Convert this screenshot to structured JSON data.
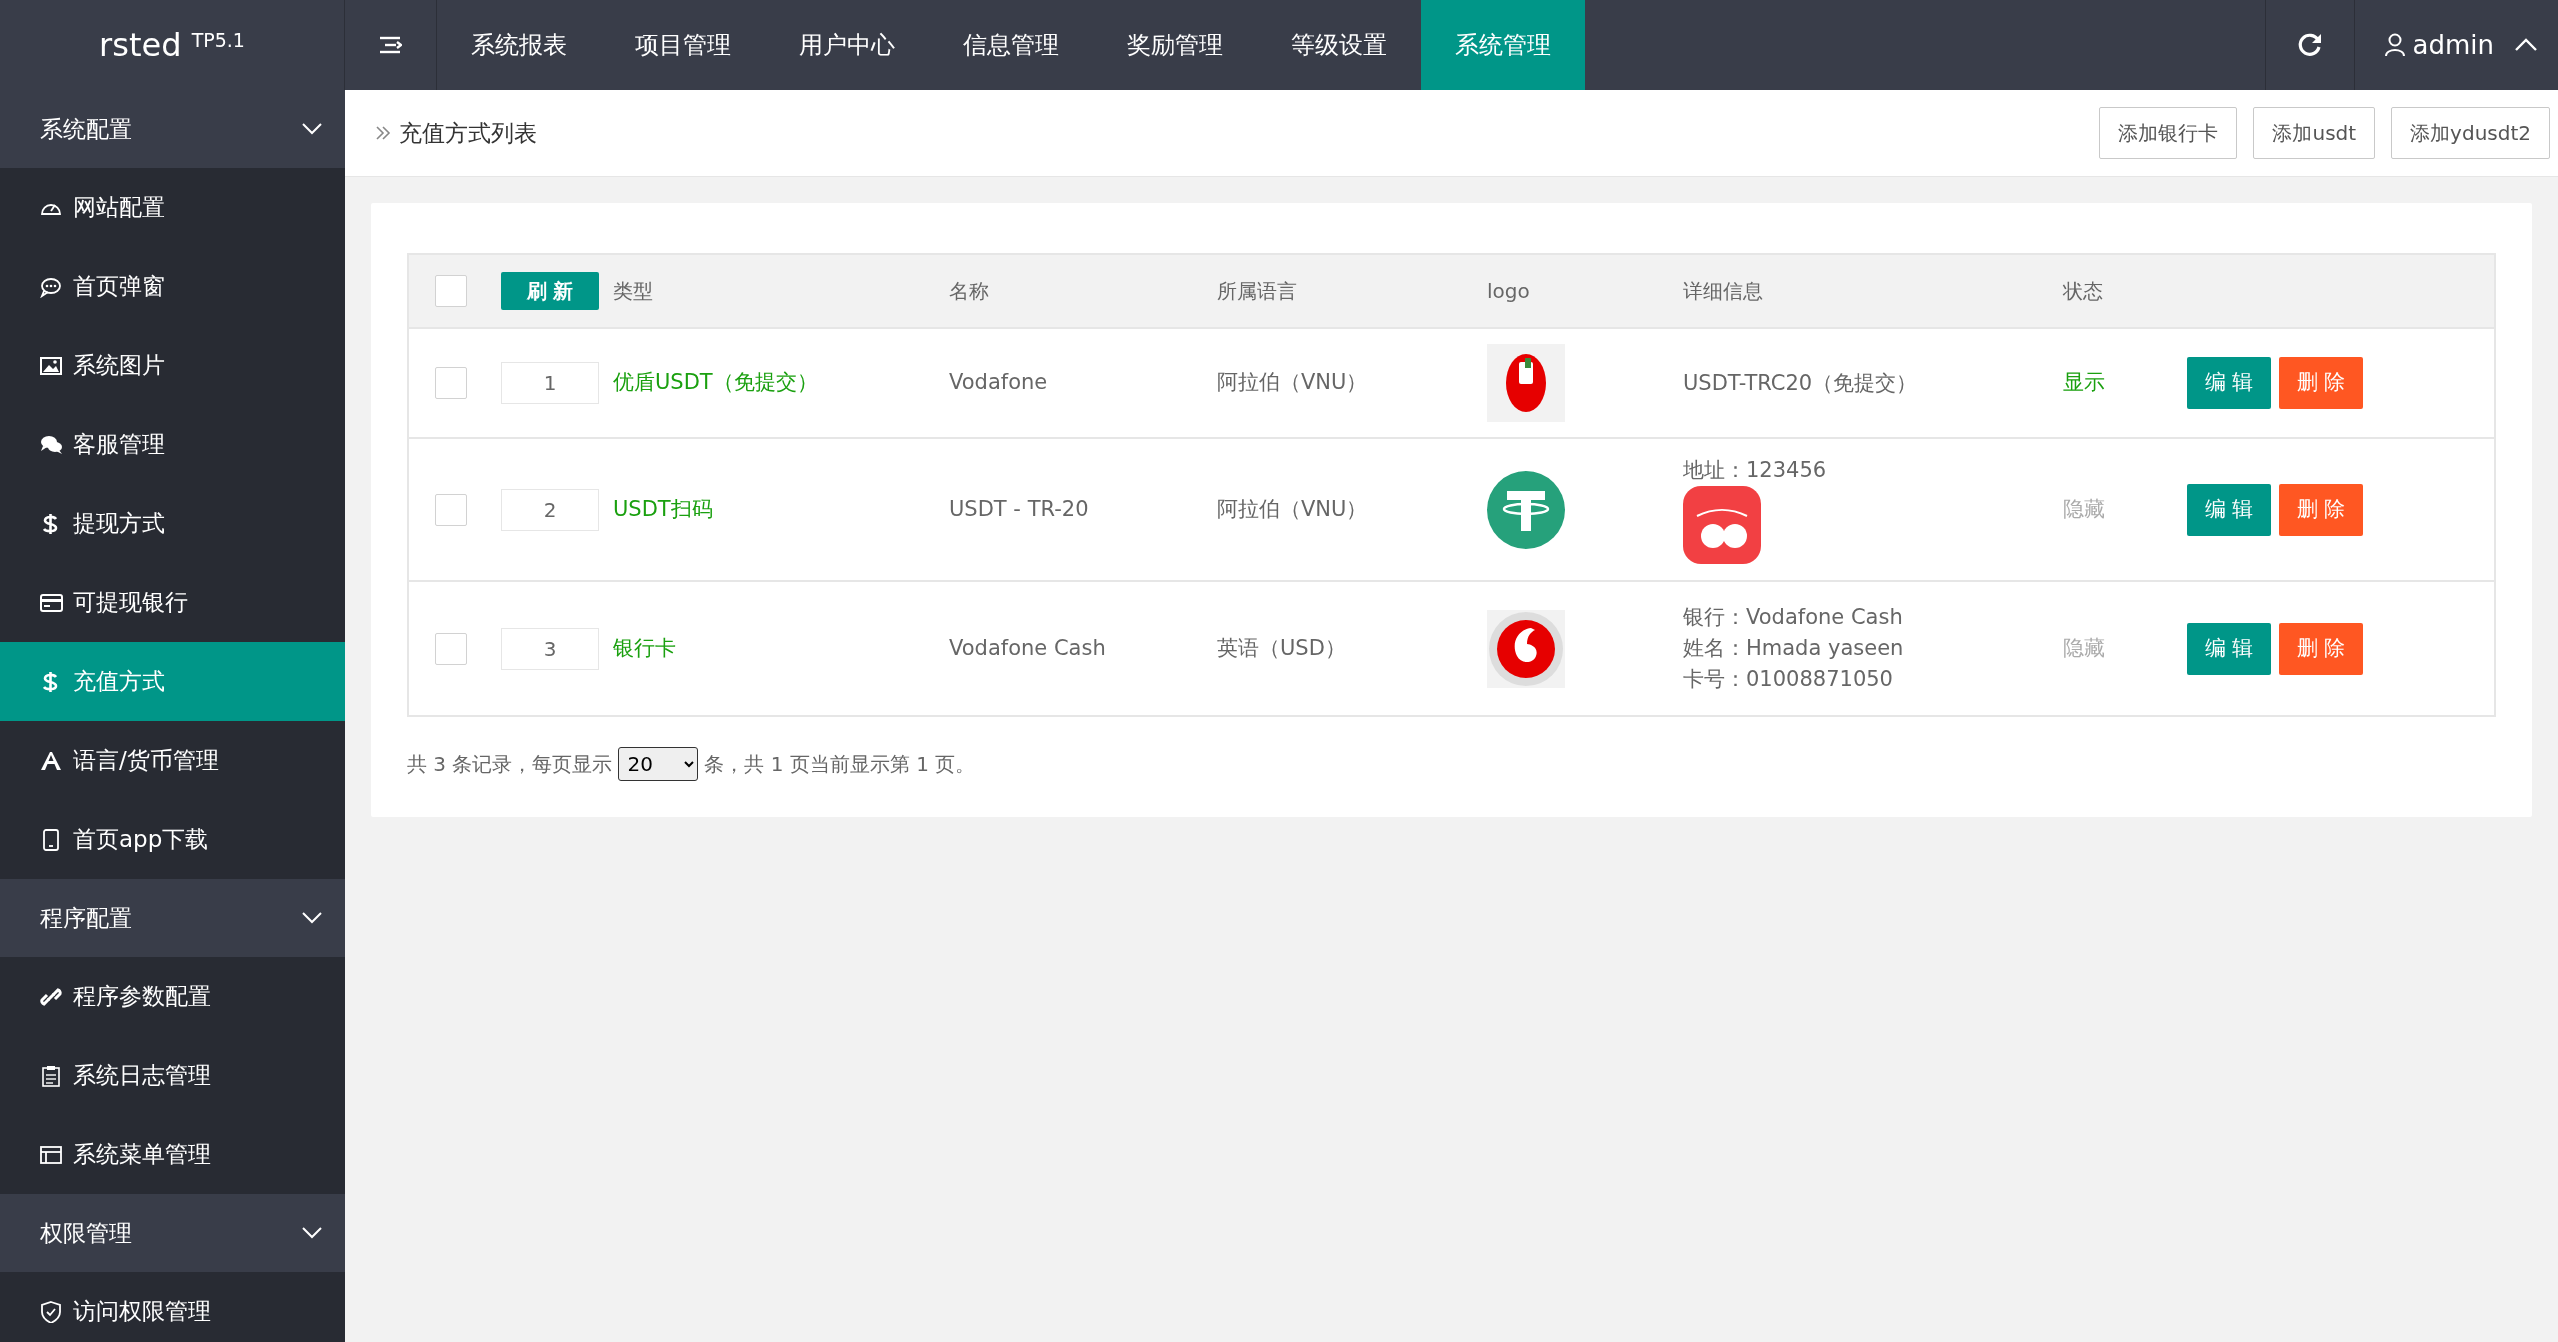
{
  "brand": {
    "name": "rsted",
    "version": "TP5.1"
  },
  "top_nav": [
    {
      "label": "系统报表",
      "selected": false
    },
    {
      "label": "项目管理",
      "selected": false
    },
    {
      "label": "用户中心",
      "selected": false
    },
    {
      "label": "信息管理",
      "selected": false
    },
    {
      "label": "奖励管理",
      "selected": false
    },
    {
      "label": "等级设置",
      "selected": false
    },
    {
      "label": "系统管理",
      "selected": true
    }
  ],
  "user": {
    "name": "admin"
  },
  "sidebar": [
    {
      "title": "系统配置",
      "expanded": true,
      "items": [
        {
          "label": "网站配置",
          "selected": false
        },
        {
          "label": "首页弹窗",
          "selected": false
        },
        {
          "label": "系统图片",
          "selected": false
        },
        {
          "label": "客服管理",
          "selected": false
        },
        {
          "label": "提现方式",
          "selected": false
        },
        {
          "label": "可提现银行",
          "selected": false
        },
        {
          "label": "充值方式",
          "selected": true
        },
        {
          "label": "语言/货币管理",
          "selected": false
        },
        {
          "label": "首页app下载",
          "selected": false
        }
      ]
    },
    {
      "title": "程序配置",
      "expanded": true,
      "items": [
        {
          "label": "程序参数配置",
          "selected": false
        },
        {
          "label": "系统日志管理",
          "selected": false
        },
        {
          "label": "系统菜单管理",
          "selected": false
        }
      ]
    },
    {
      "title": "权限管理",
      "expanded": true,
      "items": [
        {
          "label": "访问权限管理",
          "selected": false
        }
      ]
    }
  ],
  "breadcrumb": "充值方式列表",
  "actions": [
    "添加银行卡",
    "添加usdt",
    "添加ydusdt2"
  ],
  "table": {
    "header_checked": false,
    "refresh_button": "刷 新",
    "columns": [
      "类型",
      "名称",
      "所属语言",
      "logo",
      "详细信息",
      "状态"
    ],
    "rows": [
      {
        "checked": false,
        "sort": "1",
        "type": "优盾USDT（免提交）",
        "name": "Vodafone",
        "language": "阿拉伯（VNU）",
        "details": [
          "USDT-TRC20（免提交）"
        ],
        "detail_image": false,
        "status": "显示",
        "visible": true,
        "edit": "编 辑",
        "delete": "删 除"
      },
      {
        "checked": false,
        "sort": "2",
        "type": "USDT扫码",
        "name": "USDT - TR-20",
        "language": "阿拉伯（VNU）",
        "details": [
          "地址：123456"
        ],
        "detail_image": true,
        "status": "隐藏",
        "visible": false,
        "edit": "编 辑",
        "delete": "删 除"
      },
      {
        "checked": false,
        "sort": "3",
        "type": "银行卡",
        "name": "Vodafone Cash",
        "language": "英语（USD）",
        "details": [
          "银行：Vodafone Cash",
          "姓名：Hmada yaseen",
          "卡号：01008871050"
        ],
        "detail_image": false,
        "status": "隐藏",
        "visible": false,
        "edit": "编 辑",
        "delete": "删 除"
      }
    ]
  },
  "pager": {
    "before": "共 3 条记录，每页显示",
    "page_size": "20",
    "after": "条，共 1 页当前显示第 1 页。"
  }
}
